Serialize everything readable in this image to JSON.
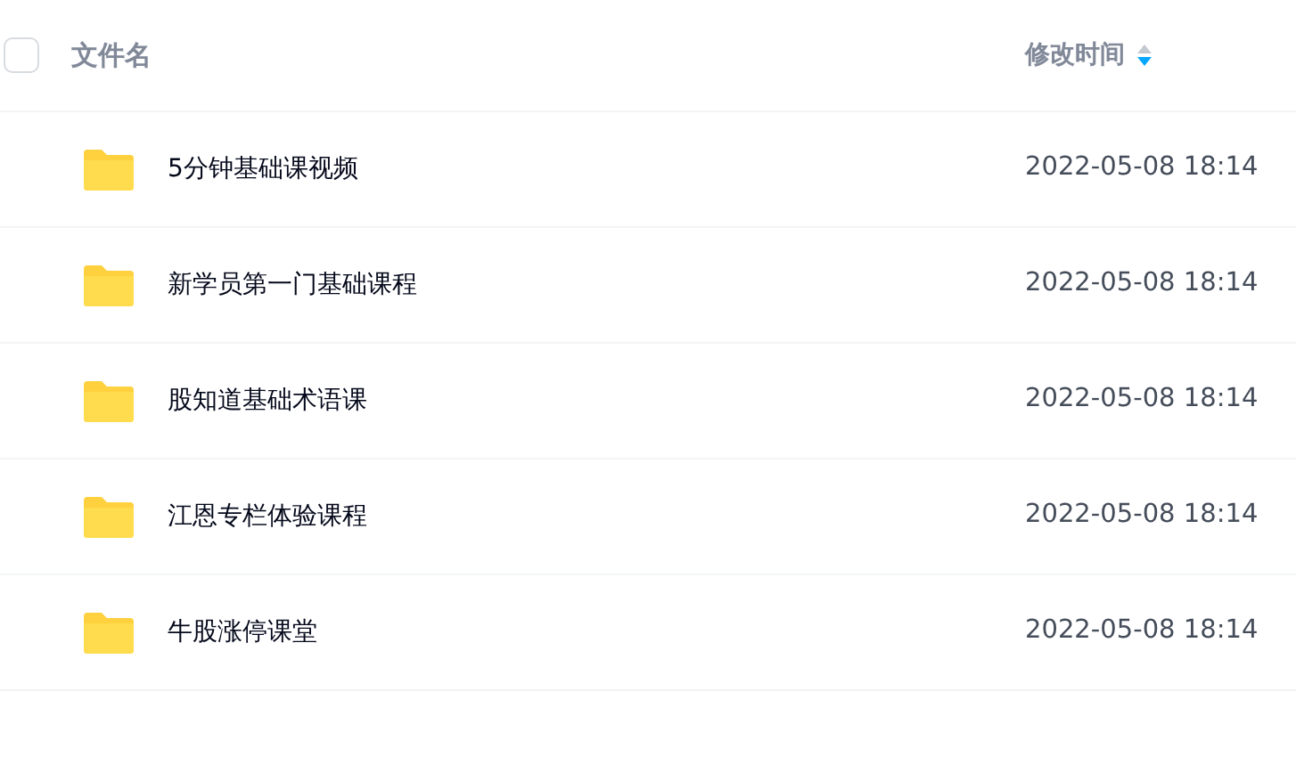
{
  "header": {
    "select_all": {
      "checked": false
    },
    "columns": [
      {
        "label": "文件名"
      },
      {
        "label": "修改时间",
        "sort_descending": true
      }
    ]
  },
  "rows": [
    {
      "name": "5分钟基础课视频",
      "modified": "2022-05-08 18:14"
    },
    {
      "name": "新学员第一门基础课程",
      "modified": "2022-05-08 18:14"
    },
    {
      "name": "股知道基础术语课",
      "modified": "2022-05-08 18:14"
    },
    {
      "name": "江恩专栏体验课程",
      "modified": "2022-05-08 18:14"
    },
    {
      "name": "牛股涨停课堂",
      "modified": "2022-05-08 18:14"
    }
  ]
}
